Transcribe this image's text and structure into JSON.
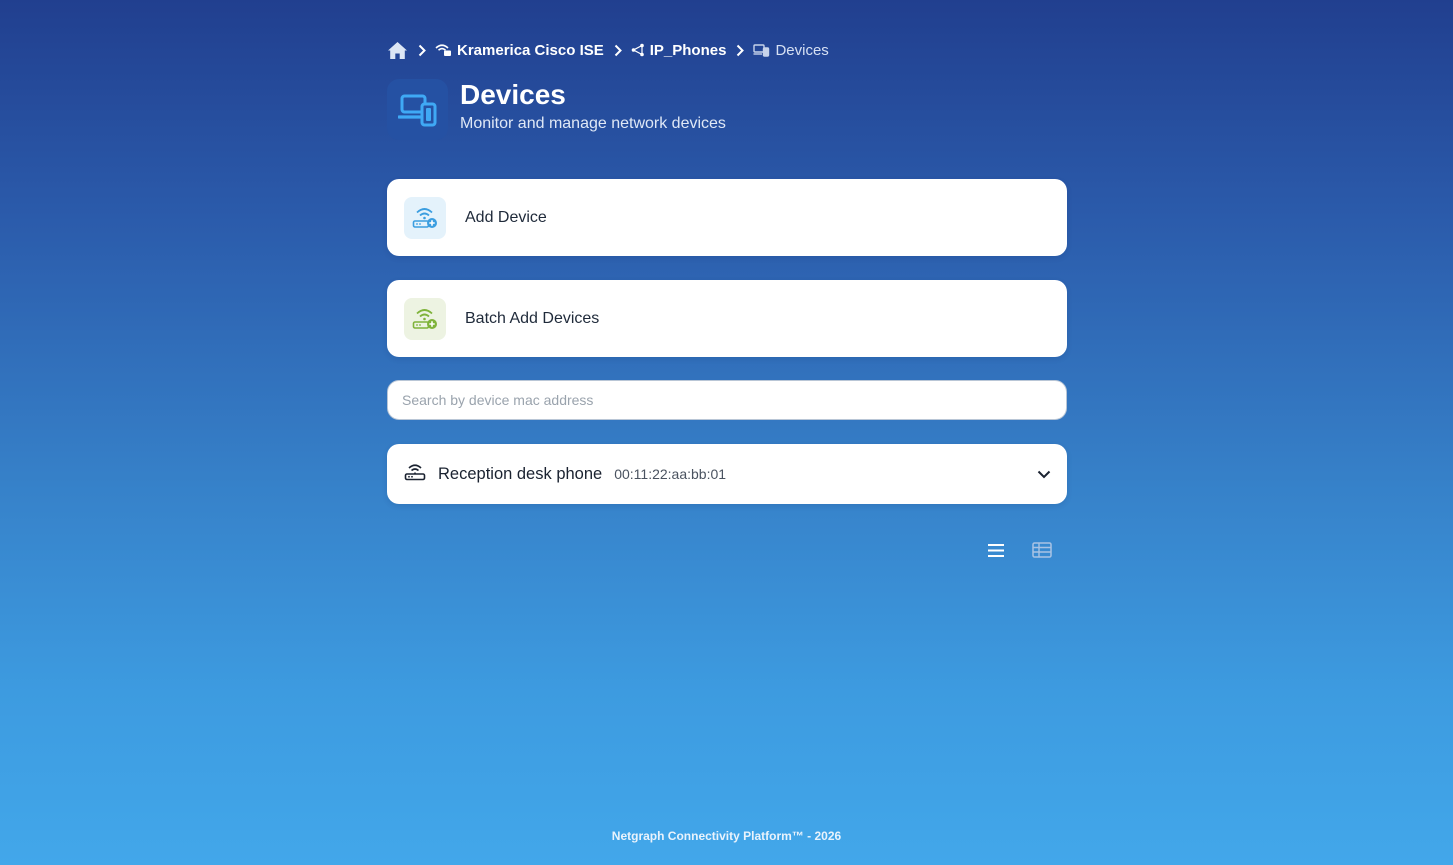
{
  "breadcrumb": {
    "home_icon": "home-icon",
    "items": [
      {
        "label": "Kramerica Cisco ISE",
        "icon": "wifi-router-icon"
      },
      {
        "label": "IP_Phones",
        "icon": "network-branch-icon"
      },
      {
        "label": "Devices",
        "icon": "devices-icon"
      }
    ],
    "separator_icon": "chevron-right-icon"
  },
  "header": {
    "title": "Devices",
    "subtitle": "Monitor and manage network devices",
    "icon": "devices-icon"
  },
  "actions": {
    "add_device": {
      "label": "Add Device",
      "icon": "router-add-icon",
      "color": "#3b9ee0"
    },
    "batch_add": {
      "label": "Batch Add Devices",
      "icon": "router-batch-add-icon",
      "color": "#7fb33a"
    }
  },
  "search": {
    "placeholder": "Search by device mac address",
    "value": ""
  },
  "devices": [
    {
      "name": "Reception desk phone",
      "mac": "00:11:22:aa:bb:01",
      "icon": "router-icon",
      "expand_icon": "chevron-down-icon"
    }
  ],
  "view_toggles": [
    {
      "name": "list-view",
      "icon": "list-icon",
      "active": true
    },
    {
      "name": "table-view",
      "icon": "table-icon",
      "active": false
    }
  ],
  "footer": {
    "text": "Netgraph Connectivity Platform™ - 2026"
  },
  "colors": {
    "bg_top": "#213f8f",
    "bg_bottom": "#42a7ea",
    "card": "#ffffff",
    "accent_blue": "#3b9ee0",
    "accent_green": "#7fb33a"
  }
}
